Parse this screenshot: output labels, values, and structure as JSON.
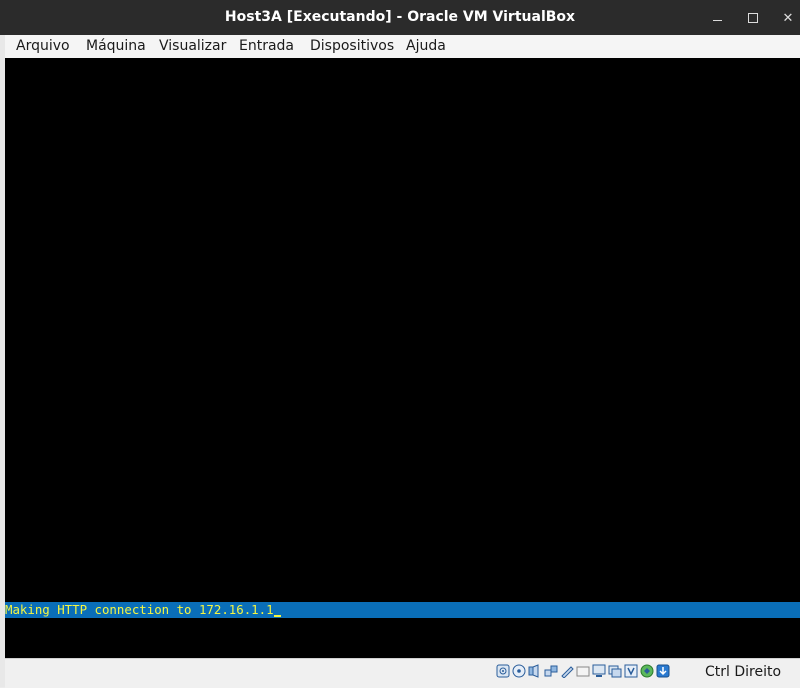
{
  "window": {
    "title": "Host3A [Executando] - Oracle VM VirtualBox"
  },
  "menu": {
    "items": [
      {
        "label": "Arquivo"
      },
      {
        "label": "Máquina"
      },
      {
        "label": "Visualizar"
      },
      {
        "label": "Entrada"
      },
      {
        "label": "Dispositivos"
      },
      {
        "label": "Ajuda"
      }
    ]
  },
  "console": {
    "line": "Making HTTP connection to 172.16.1.1"
  },
  "statusbar": {
    "icons": [
      "hard-disk-icon",
      "optical-disk-icon",
      "audio-icon",
      "network-icon",
      "usb-icon",
      "shared-folders-icon",
      "display-icon",
      "video-capture-icon",
      "virtualization-icon",
      "mouse-integration-icon",
      "keyboard-capture-icon"
    ],
    "host_key": "Ctrl Direito"
  },
  "colors": {
    "titlebar_bg": "#2b2b2b",
    "console_highlight": "#0a6eb8",
    "console_text": "#f5f542"
  }
}
